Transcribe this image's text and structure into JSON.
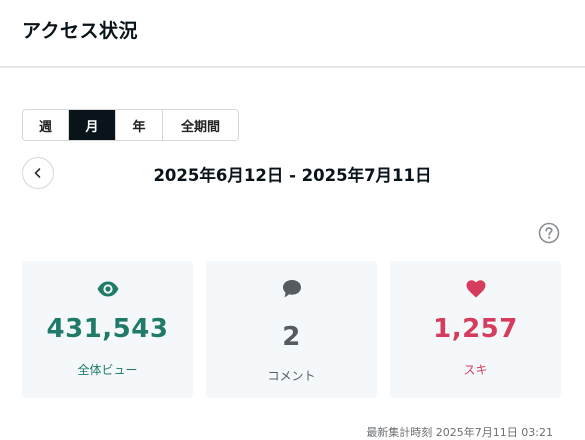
{
  "header": {
    "title": "アクセス状況"
  },
  "period_tabs": [
    {
      "label": "週",
      "active": false
    },
    {
      "label": "月",
      "active": true
    },
    {
      "label": "年",
      "active": false
    },
    {
      "label": "全期間",
      "active": false
    }
  ],
  "date_range": "2025年6月12日 - 2025年7月11日",
  "stats": {
    "views": {
      "value": "431,543",
      "label": "全体ビュー",
      "color": "#1f7a6a",
      "icon": "eye-icon"
    },
    "comments": {
      "value": "2",
      "label": "コメント",
      "color": "#555c61",
      "icon": "speech-bubble-icon"
    },
    "likes": {
      "value": "1,257",
      "label": "スキ",
      "color": "#d63c5e",
      "icon": "heart-icon"
    }
  },
  "footer": {
    "updated_at": "最新集計時刻 2025年7月11日 03:21"
  }
}
